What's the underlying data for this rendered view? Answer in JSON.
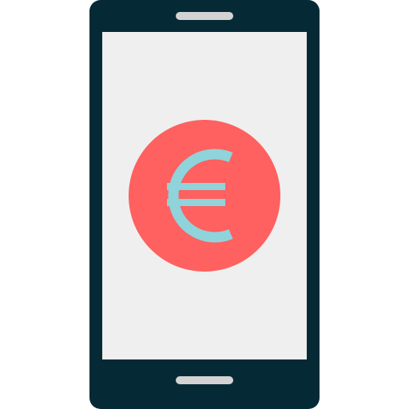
{
  "icon": {
    "name": "smartphone-euro-icon",
    "colors": {
      "phone_body": "#062a35",
      "speaker": "#d3d3d3",
      "screen": "#efefef",
      "home_button": "#d3d3d3",
      "coin": "#ff6060",
      "euro_symbol": "#8fd3db"
    },
    "parts": {
      "device": "smartphone-icon",
      "symbol": "euro-sign-icon"
    }
  }
}
